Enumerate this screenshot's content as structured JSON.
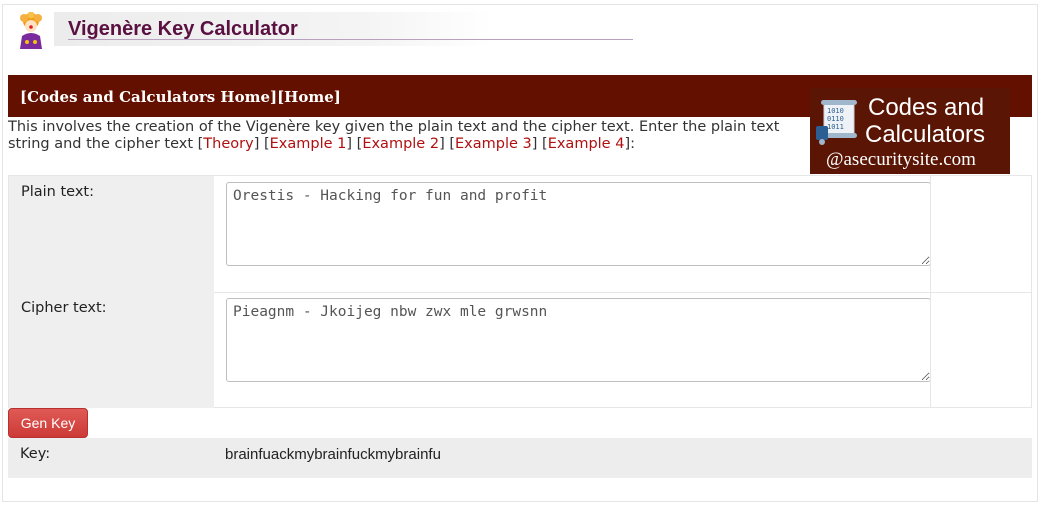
{
  "header": {
    "title": "Vigenère Key Calculator"
  },
  "nav": {
    "links": "[Codes and Calculators Home][Home]"
  },
  "logo": {
    "line1": "Codes and",
    "line2": "Calculators",
    "line3": "@asecuritysite.com"
  },
  "intro": {
    "text_part1": "This involves the creation of the Vigenère key given the plain text and the cipher text. Enter the plain text string and the cipher text [",
    "theory": "Theory",
    "sep1": "] [",
    "example1": "Example 1",
    "sep2": "] [",
    "example2": "Example 2",
    "sep3": "] [",
    "example3": "Example 3",
    "sep4": "] [",
    "example4": "Example 4",
    "text_end": "]:"
  },
  "form": {
    "plain_label": "Plain text:",
    "plain_value": "Orestis - Hacking for fun and profit",
    "cipher_label": "Cipher text:",
    "cipher_value": "Pieagnm - Jkoijeg nbw zwx mle grwsnn"
  },
  "actions": {
    "gen_key_label": "Gen Key"
  },
  "result": {
    "key_label": "Key:",
    "key_value": "brainfuackmybrainfuckmybrainfu"
  },
  "colors": {
    "navbar": "#641000",
    "title": "#5a1040",
    "link": "#b01010",
    "button": "#d9534f"
  }
}
